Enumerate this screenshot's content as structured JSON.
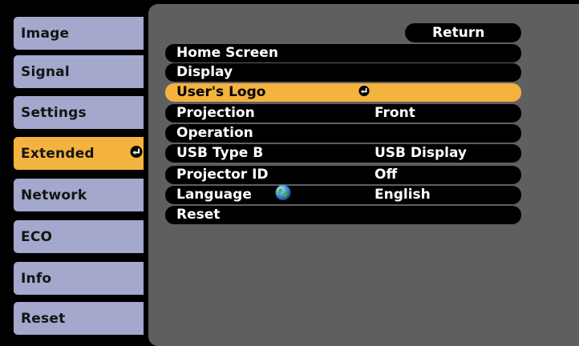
{
  "tabs": [
    {
      "label": "Image"
    },
    {
      "label": "Signal"
    },
    {
      "label": "Settings"
    },
    {
      "label": "Extended",
      "icon": "enter-icon"
    },
    {
      "label": "Network"
    },
    {
      "label": "ECO"
    },
    {
      "label": "Info"
    },
    {
      "label": "Reset"
    }
  ],
  "selected_tab": "Extended",
  "panel": {
    "return_label": "Return",
    "rows": [
      {
        "label": "Home Screen",
        "value": ""
      },
      {
        "label": "Display",
        "value": ""
      },
      {
        "label": "User's Logo",
        "value": "",
        "icon": "enter-icon"
      },
      {
        "label": "Projection",
        "value": "Front"
      },
      {
        "label": "Operation",
        "value": ""
      },
      {
        "label": "USB Type B",
        "value": "USB Display"
      },
      {
        "label": "Projector ID",
        "value": "Off"
      },
      {
        "label": "Language",
        "value": "English",
        "icon": "globe-icon"
      },
      {
        "label": "Reset",
        "value": ""
      }
    ],
    "selected_row": "User's Logo"
  },
  "colors": {
    "background": "#000000",
    "tab": "#a3a8cc",
    "highlight": "#f3b33e",
    "panel": "#5f5f5f",
    "row": "#000000",
    "text_light": "#ffffff",
    "text_dark": "#141414"
  }
}
